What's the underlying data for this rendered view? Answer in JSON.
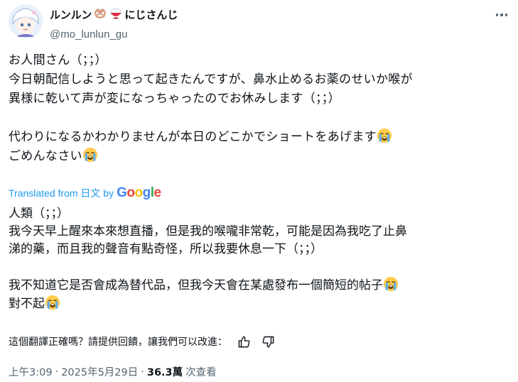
{
  "author": {
    "display_name": "ルンルン",
    "display_name_suffix": "にじさんじ",
    "handle": "@mo_lunlun_gu",
    "emoji_1": "pretzel-emoji",
    "emoji_2": "rice-bowl-emoji",
    "avatar": "avatar"
  },
  "more_icon": "more-options-icon",
  "original": {
    "line1": "お人間さん（；；）",
    "line2": "今日朝配信しようと思って起きたんですが、鼻水止めるお薬のせいか喉が",
    "line3": "異様に乾いて声が変になっちゃったのでお休みします（；；）",
    "line5": "代わりになるかわかりませんが本日のどこかでショートをあげます",
    "line6": "ごめんなさい"
  },
  "translation_credit": {
    "prefix": "Translated from 日文 by",
    "google": "Google"
  },
  "translation": {
    "line1": "人類（；；）",
    "line2": "我今天早上醒來本來想直播，但是我的喉嚨非常乾，可能是因為我吃了止鼻",
    "line3": "涕的藥，而且我的聲音有點奇怪，所以我要休息一下（；；）",
    "line5": "我不知道它是否會成為替代品，但我今天會在某處發布一個簡短的帖子",
    "line6": "對不起"
  },
  "feedback": {
    "question": "這個翻譯正確嗎？請提供回饋，讓我們可以改進：",
    "thumbs_up": "thumbs-up-icon",
    "thumbs_down": "thumbs-down-icon"
  },
  "meta": {
    "time": "上午3:09",
    "separator": "·",
    "date": "2025年5月29日",
    "views_count": "36.3萬",
    "views_label": "次查看"
  },
  "colors": {
    "link": "#1d9bf0",
    "secondary_text": "#536471",
    "primary_text": "#0f1419"
  }
}
